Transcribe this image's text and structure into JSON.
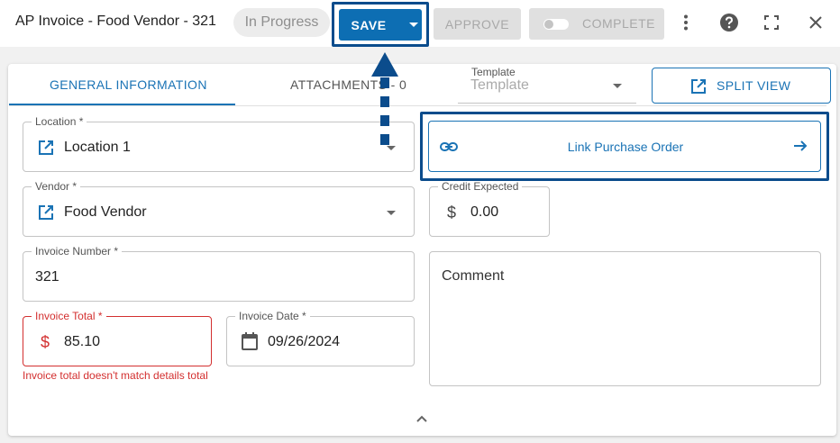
{
  "header": {
    "title": "AP Invoice - Food Vendor - 321",
    "status": "In Progress",
    "save_label": "SAVE",
    "approve_label": "APPROVE",
    "complete_label": "COMPLETE"
  },
  "tabs": [
    {
      "label": "GENERAL INFORMATION",
      "active": true
    },
    {
      "label": "ATTACHMENTS - 0",
      "active": false
    }
  ],
  "template": {
    "label": "Template",
    "placeholder": "Template"
  },
  "split_view_label": "SPLIT VIEW",
  "link_po_label": "Link Purchase Order",
  "fields": {
    "location": {
      "label": "Location *",
      "value": "Location 1"
    },
    "vendor": {
      "label": "Vendor *",
      "value": "Food Vendor"
    },
    "credit_expected": {
      "label": "Credit Expected",
      "symbol": "$",
      "value": "0.00"
    },
    "invoice_number": {
      "label": "Invoice Number *",
      "value": "321"
    },
    "invoice_total": {
      "label": "Invoice Total *",
      "symbol": "$",
      "value": "85.10",
      "error": "Invoice total doesn't match details total"
    },
    "invoice_date": {
      "label": "Invoice Date *",
      "value": "09/26/2024"
    },
    "comment": {
      "label": "Comment"
    }
  },
  "colors": {
    "primary": "#1a73b5",
    "save_button": "#0d6eb3",
    "highlight_border": "#0b4c8c",
    "error": "#d32f2f"
  },
  "icons": [
    "more-vert-icon",
    "help-icon",
    "fullscreen-icon",
    "close-icon",
    "open-in-new-icon",
    "link-icon",
    "arrow-right-icon",
    "calendar-icon",
    "dollar-icon",
    "chevron-up-icon"
  ]
}
